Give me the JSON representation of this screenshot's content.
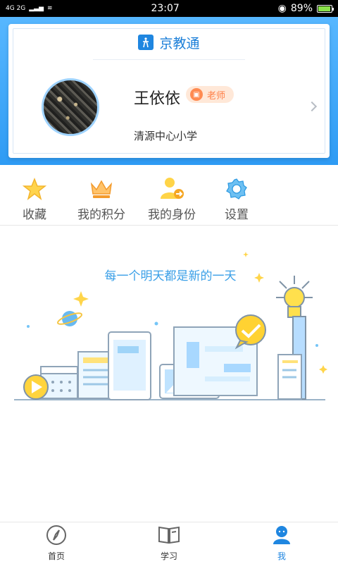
{
  "status": {
    "network": "4G 2G",
    "time": "23:07",
    "battery": "89%"
  },
  "header": {
    "app_title": "京教通",
    "name": "王依依",
    "role": "老师",
    "school": "清源中心小学"
  },
  "quick_actions": [
    {
      "label": "收藏",
      "icon": "star-icon"
    },
    {
      "label": "我的积分",
      "icon": "crown-icon"
    },
    {
      "label": "我的身份",
      "icon": "identity-icon"
    },
    {
      "label": "设置",
      "icon": "gear-icon"
    }
  ],
  "hero_text": "每一个明天都是新的一天",
  "tabs": [
    {
      "label": "首页",
      "icon": "compass-icon"
    },
    {
      "label": "学习",
      "icon": "book-icon"
    },
    {
      "label": "我",
      "icon": "user-icon"
    }
  ],
  "colors": {
    "accent": "#1f86e0",
    "header_top": "#57b7ff",
    "header_bottom": "#2e9bf4",
    "role_badge": "#ffe8d8",
    "role_text": "#ff7e45"
  }
}
